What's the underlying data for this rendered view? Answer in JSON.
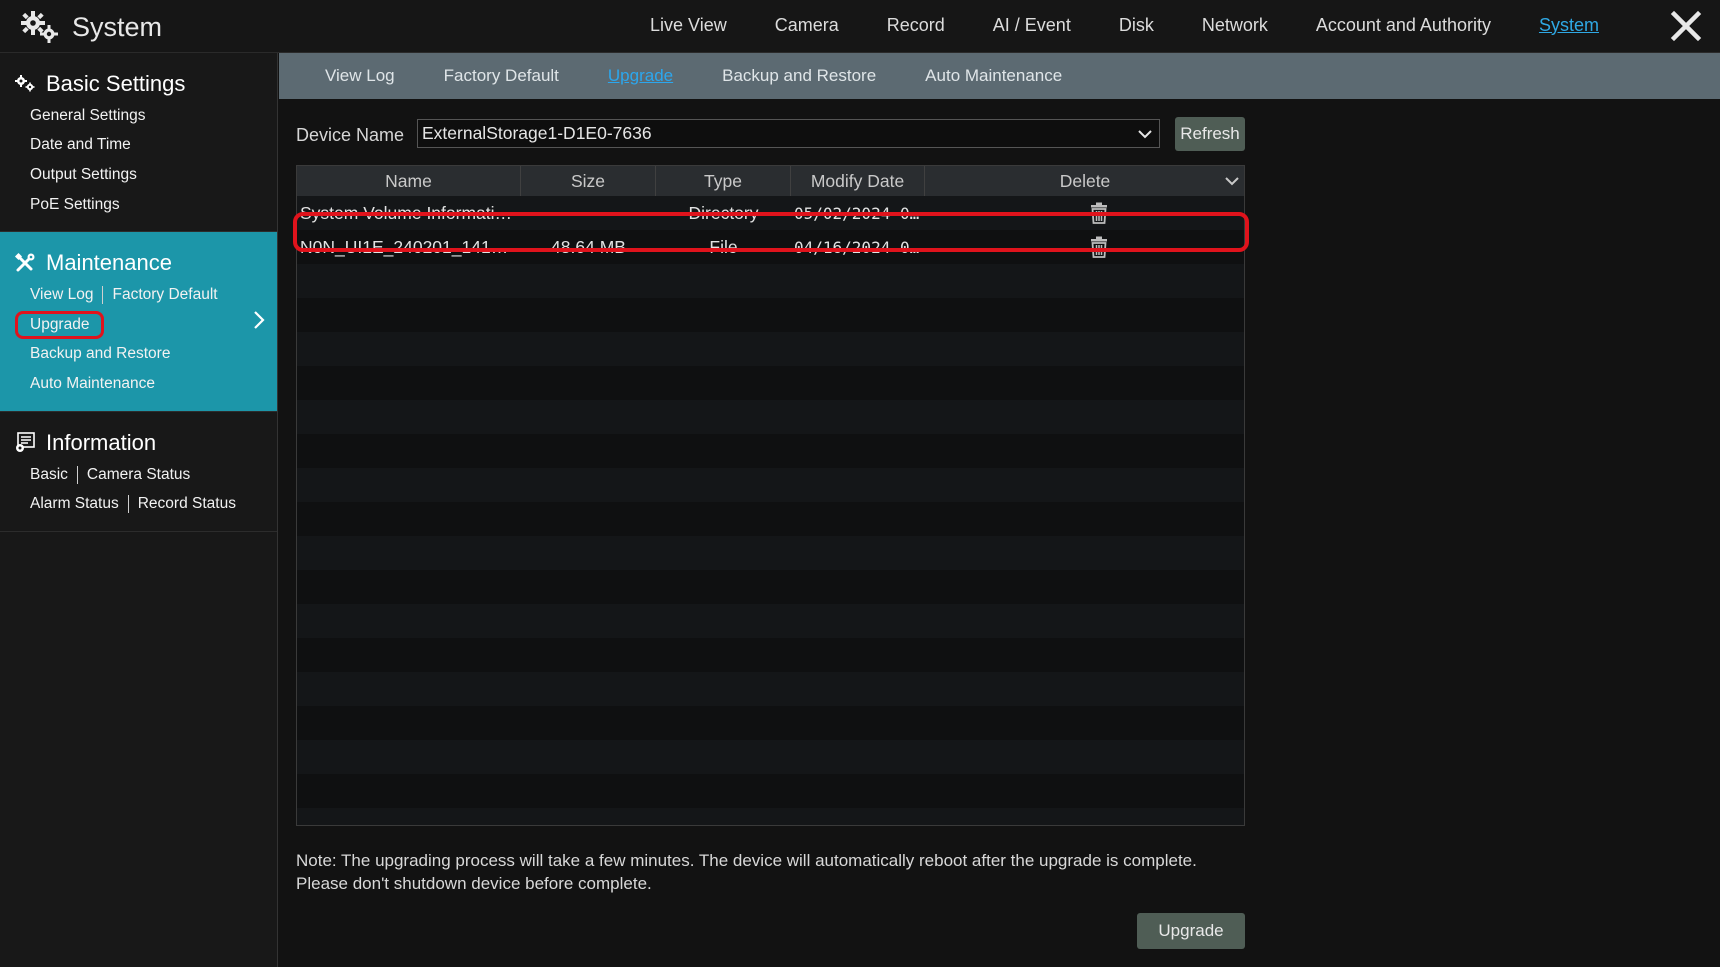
{
  "app": {
    "title": "System"
  },
  "topnav": {
    "items": [
      {
        "label": "Live View",
        "name": "topnav-live-view"
      },
      {
        "label": "Camera",
        "name": "topnav-camera"
      },
      {
        "label": "Record",
        "name": "topnav-record"
      },
      {
        "label": "AI / Event",
        "name": "topnav-ai-event"
      },
      {
        "label": "Disk",
        "name": "topnav-disk"
      },
      {
        "label": "Network",
        "name": "topnav-network"
      },
      {
        "label": "Account and Authority",
        "name": "topnav-account-authority"
      },
      {
        "label": "System",
        "name": "topnav-system"
      }
    ],
    "active": "System"
  },
  "sidebar": {
    "basic": {
      "label": "Basic Settings",
      "items": [
        "General Settings",
        "Date and Time",
        "Output Settings",
        "PoE Settings"
      ]
    },
    "maintenance": {
      "label": "Maintenance",
      "items": [
        "View Log",
        "Factory Default",
        "Upgrade",
        "Backup and Restore",
        "Auto Maintenance"
      ],
      "selected": "Upgrade"
    },
    "information": {
      "label": "Information",
      "items": [
        "Basic",
        "Camera Status",
        "Alarm Status",
        "Record Status"
      ]
    }
  },
  "subtabs": {
    "items": [
      "View Log",
      "Factory Default",
      "Upgrade",
      "Backup and Restore",
      "Auto Maintenance"
    ],
    "active": "Upgrade"
  },
  "device": {
    "label": "Device Name",
    "value": "ExternalStorage1-D1E0-7636",
    "refresh_label": "Refresh"
  },
  "table": {
    "columns": [
      "Name",
      "Size",
      "Type",
      "Modify Date",
      "Delete"
    ],
    "rows": [
      {
        "name": "System Volume Informati…",
        "size": "",
        "type": "Directory",
        "date": "05/02/2024 0…"
      },
      {
        "name": "N0N_UI1E_240201_141…",
        "size": "48.64 MB",
        "type": "File",
        "date": "04/16/2024 0…"
      }
    ],
    "highlighted_row": 1
  },
  "note": {
    "line1": "Note: The upgrading process will take a few minutes. The device will automatically reboot after the upgrade is complete.",
    "line2": "Please don't shutdown device before complete."
  },
  "upgrade_label": "Upgrade",
  "colors": {
    "accent": "#2fa8e4",
    "maintenance_bg": "#1c96a9",
    "highlight": "#e0131c",
    "button_bg": "#4f5d55",
    "subtab_bg": "#5c6a72"
  }
}
